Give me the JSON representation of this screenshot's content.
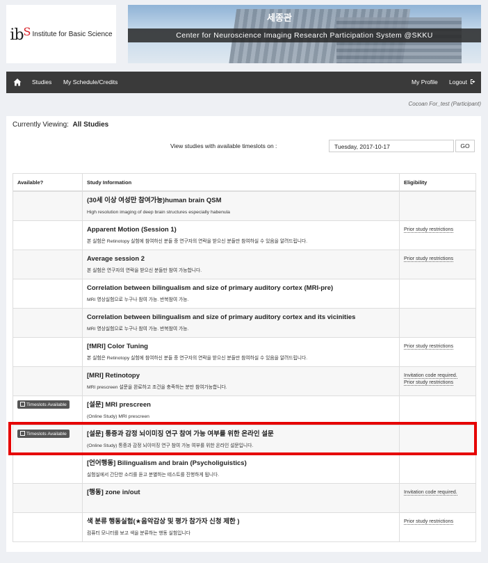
{
  "logo": {
    "mark": "ib",
    "mark_s": "S",
    "text": "Institute for Basic Science"
  },
  "banner": {
    "sign": "세종관",
    "title": "Center for Neuroscience Imaging Research Participation System @SKKU"
  },
  "nav": {
    "home_icon": "home-icon",
    "studies": "Studies",
    "schedule": "My Schedule/Credits",
    "profile": "My Profile",
    "logout": "Logout",
    "logout_icon": "sign-out-icon"
  },
  "user": "Cocoan For_test (Participant)",
  "viewing": {
    "label": "Currently Viewing:",
    "value": "All Studies"
  },
  "date_filter": {
    "label": "View studies with available timeslots on :",
    "value": "Tuesday, 2017-10-17",
    "go": "GO"
  },
  "table": {
    "headers": [
      "Available?",
      "Study Information",
      "Eligibility"
    ],
    "rows": [
      {
        "available": "",
        "title": "(30세 이상 여성만 참여가능)human brain QSM",
        "desc": "High resolution imaging of deep brain structures especially habenula",
        "eligibility": []
      },
      {
        "available": "",
        "title": "Apparent Motion (Session 1)",
        "desc": "본 실험은 Retinotopy 실험에 참여하신 분들 중 연구자의 연락을 받으신 분들만 참여하실 수 있음을 알려드립니다.",
        "eligibility": [
          "Prior study restrictions"
        ]
      },
      {
        "available": "",
        "title": "Average session 2",
        "desc": "본 실험은 연구자의 연락을 받으신 분들만 참여 가능합니다.",
        "eligibility": [
          "Prior study restrictions"
        ]
      },
      {
        "available": "",
        "title": "Correlation between bilingualism and size of primary auditory cortex (MRI-pre)",
        "desc": "MRI 영상실험으로 누구나 참여 가능. 반복참여 가능.",
        "eligibility": []
      },
      {
        "available": "",
        "title": "Correlation between bilingualism and size of primary auditory cortex and its vicinities",
        "desc": "MRI 영상실험으로 누구나 참여 가능. 반복참여 가능.",
        "eligibility": []
      },
      {
        "available": "",
        "title": "[fMRI] Color Tuning",
        "desc": "본 실험은 Retinotopy 실험에 참여하신 분들 중 연구자의 연락을 받으신 분들만 참여하실 수 있음을 알려드립니다.",
        "eligibility": [
          "Prior study restrictions"
        ]
      },
      {
        "available": "",
        "title": "[MRI] Retinotopy",
        "desc": "MRI prescreen 설문을 완료하고 조건을 충족하는 분만 참여가능합니다.",
        "eligibility": [
          "Invitation code required.",
          "Prior study restrictions"
        ]
      },
      {
        "available": "Timeslots Available",
        "title": "[설문] MRI prescreen",
        "desc": "(Online Study) MRI prescreen",
        "eligibility": []
      },
      {
        "available": "Timeslots Available",
        "title": "[설문] 통증과 감정 뇌이미징 연구 참여 가능 여부를 위한 온라인 설문",
        "desc": "(Online Study) 통증과 감정 뇌이미징 연구 참여 가능 여부를 위한 온라인 설문입니다.",
        "eligibility": []
      },
      {
        "available": "",
        "title": "[언어행동] Bilingualism and brain (Psycholiguistics)",
        "desc": "실험실에서 간단한 소리를 듣고 분별하는 테스트를 진행하게 됩니다.",
        "eligibility": []
      },
      {
        "available": "",
        "title": "[행동] zone in/out",
        "desc": "",
        "eligibility": [
          "Invitation code required."
        ]
      },
      {
        "available": "",
        "title": "색 분류 행동실험(★음악감상 및 평가 참가자 신청 제한 )",
        "desc": "컴퓨터 모니터를 보고 색을 분류하는 행동 실험입니다",
        "eligibility": [
          "Prior study restrictions"
        ]
      }
    ]
  },
  "colors": {
    "nav_bg": "#3a3a3a",
    "highlight": "#e60000",
    "badge_bg": "#555555"
  }
}
